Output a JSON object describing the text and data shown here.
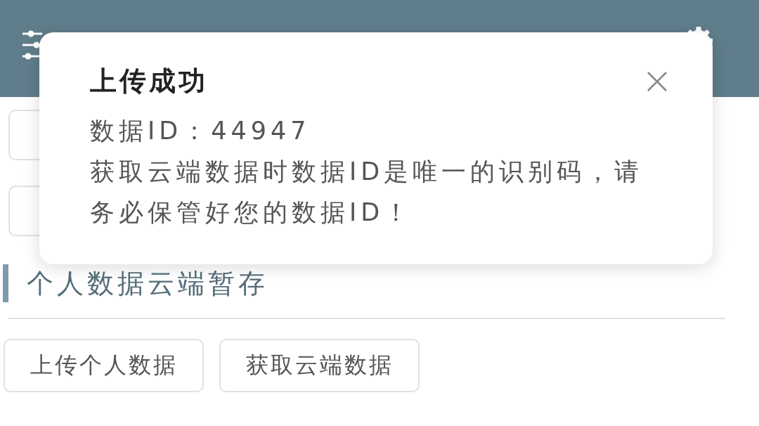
{
  "section": {
    "title": "个人数据云端暂存"
  },
  "buttons": [
    {
      "label": "上传个人数据"
    },
    {
      "label": "获取云端数据"
    }
  ],
  "toast": {
    "title": "上传成功",
    "lines": [
      "数据ID：44947",
      "获取云端数据时数据ID是唯一的识别码，请务必保管好您的数据ID！"
    ]
  }
}
